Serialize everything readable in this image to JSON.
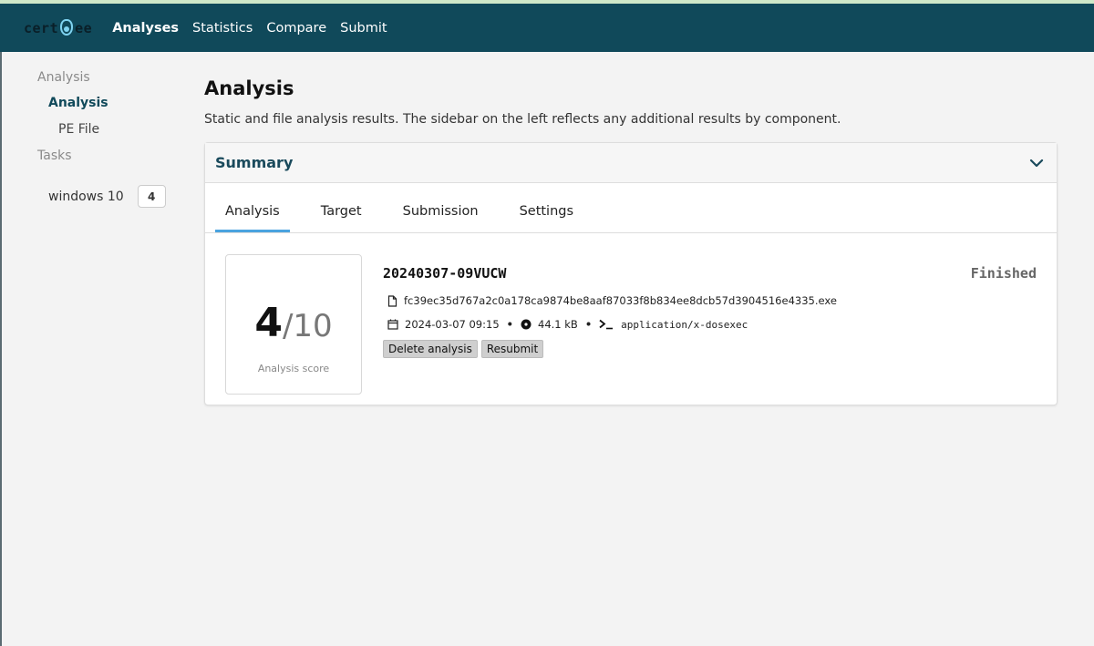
{
  "brand": {
    "left": "cert",
    "right": "ee"
  },
  "nav": {
    "items": [
      {
        "label": "Analyses",
        "active": true
      },
      {
        "label": "Statistics",
        "active": false
      },
      {
        "label": "Compare",
        "active": false
      },
      {
        "label": "Submit",
        "active": false
      }
    ]
  },
  "sidebar": {
    "analysis_section": "Analysis",
    "analysis_item": "Analysis",
    "pe_item": "PE File",
    "tasks_section": "Tasks",
    "task": {
      "label": "windows 10",
      "count": "4"
    }
  },
  "page": {
    "title": "Analysis",
    "description": "Static and file analysis results. The sidebar on the left reflects any additional results by component."
  },
  "summary": {
    "title": "Summary",
    "tabs": [
      "Analysis",
      "Target",
      "Submission",
      "Settings"
    ],
    "active_tab": "Analysis",
    "score": "4",
    "score_max": "/10",
    "score_label": "Analysis score",
    "analysis_id": "20240307-09VUCW",
    "status": "Finished",
    "filename": "fc39ec35d767a2c0a178ca9874be8aaf87033f8b834ee8dcb57d3904516e4335.exe",
    "date": "2024-03-07 09:15",
    "size": "44.1 kB",
    "mime": "application/x-dosexec",
    "delete_label": "Delete analysis",
    "resubmit_label": "Resubmit"
  },
  "colors": {
    "navbar": "#10495a",
    "accent": "#4aa3df"
  }
}
